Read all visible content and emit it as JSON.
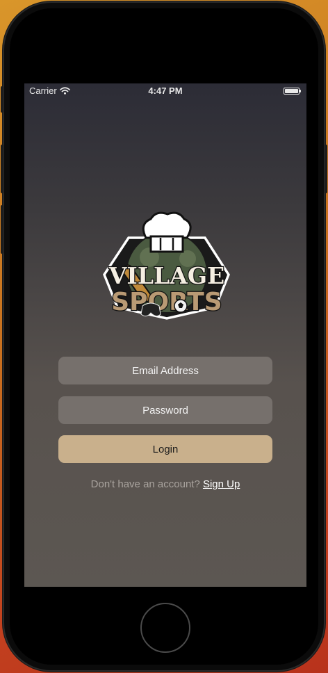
{
  "status_bar": {
    "carrier": "Carrier",
    "time": "4:47 PM",
    "wifi_icon": "wifi-icon",
    "battery_icon": "battery-icon"
  },
  "logo": {
    "line1": "VILLAGE",
    "line2": "SPORTS"
  },
  "form": {
    "email_placeholder": "Email Address",
    "password_placeholder": "Password",
    "login_label": "Login"
  },
  "signup": {
    "prompt": "Don't have an account? ",
    "link_label": "Sign Up"
  },
  "colors": {
    "login_button": "#c9b08c",
    "field_background": "#76706c"
  }
}
